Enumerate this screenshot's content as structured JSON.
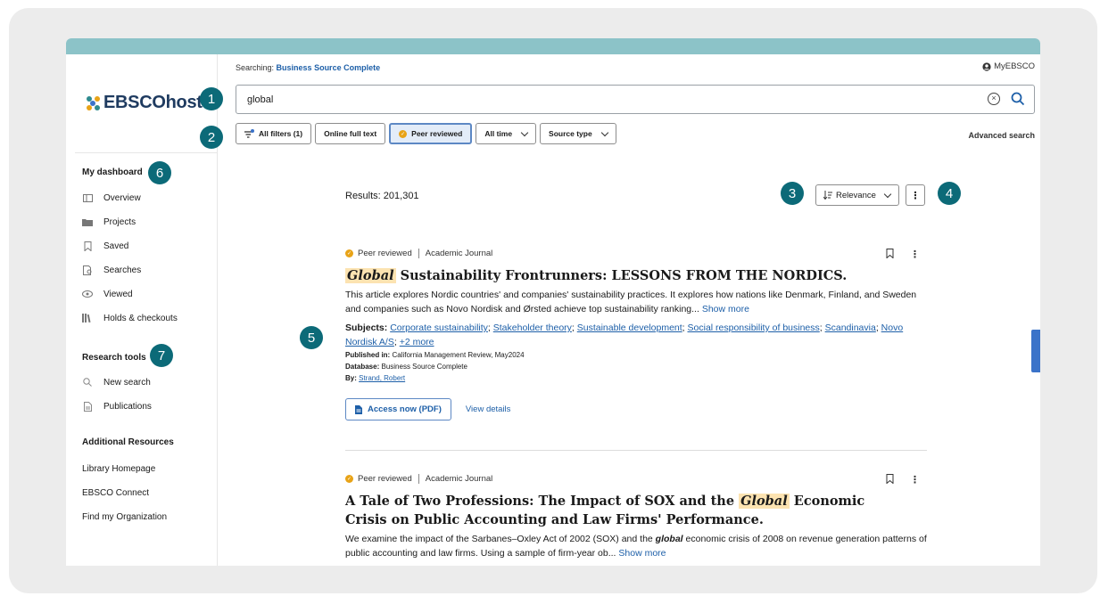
{
  "header": {
    "searching_label": "Searching:",
    "database": "Business Source Complete",
    "account": "MyEBSCO"
  },
  "logo": {
    "text": "EBSCOhost"
  },
  "search": {
    "value": "global"
  },
  "filters": {
    "all_filters": "All filters (1)",
    "online_full_text": "Online full text",
    "peer_reviewed": "Peer reviewed",
    "all_time": "All time",
    "source_type": "Source type",
    "advanced_search": "Advanced search"
  },
  "sidebar": {
    "dashboard_heading": "My dashboard",
    "dashboard_items": [
      {
        "label": "Overview",
        "icon": "overview-icon"
      },
      {
        "label": "Projects",
        "icon": "folder-icon"
      },
      {
        "label": "Saved",
        "icon": "bookmark-icon"
      },
      {
        "label": "Searches",
        "icon": "searches-icon"
      },
      {
        "label": "Viewed",
        "icon": "eye-icon"
      },
      {
        "label": "Holds & checkouts",
        "icon": "books-icon"
      }
    ],
    "tools_heading": "Research tools",
    "tools_items": [
      {
        "label": "New search",
        "icon": "search-icon"
      },
      {
        "label": "Publications",
        "icon": "document-icon"
      }
    ],
    "resources_heading": "Additional Resources",
    "resources_links": [
      "Library Homepage",
      "EBSCO Connect",
      "Find my Organization"
    ]
  },
  "results": {
    "count_label": "Results: 201,301",
    "sort_label": "Relevance",
    "items": [
      {
        "peer_label": "Peer reviewed",
        "type": "Academic Journal",
        "title_highlight": "Global",
        "title_rest": " Sustainability Frontrunners: LESSONS FROM THE NORDICS.",
        "abstract": "This article explores Nordic countries' and companies' sustainability practices. It explores how nations like Denmark, Finland, and Sweden and companies such as Novo Nordisk and Ørsted achieve top sustainability ranking...",
        "show_more": "Show more",
        "subjects_label": "Subjects:",
        "subjects": [
          "Corporate sustainability",
          "Stakeholder theory",
          "Sustainable development",
          "Social responsibility of business",
          "Scandinavia",
          "Novo Nordisk A/S"
        ],
        "subjects_more": "+2 more",
        "published_label": "Published in:",
        "published": "California Management Review, May2024",
        "database_label": "Database:",
        "database": "Business Source Complete",
        "by_label": "By:",
        "author": "Strand, Robert",
        "access_label": "Access now (PDF)",
        "view_details": "View details"
      },
      {
        "peer_label": "Peer reviewed",
        "type": "Academic Journal",
        "title_part1": "A Tale of Two Professions: The Impact of SOX and the ",
        "title_highlight": "Global",
        "title_part2": " Economic Crisis on Public Accounting and Law Firms' Performance.",
        "abstract_part1": "We examine the impact of the Sarbanes–Oxley Act of 2002 (SOX) and the ",
        "abstract_bold": "global",
        "abstract_part2": " economic crisis of 2008 on revenue generation patterns of public accounting and law firms. Using a sample of firm-year ob...",
        "show_more": "Show more"
      }
    ]
  },
  "badges": [
    "1",
    "2",
    "3",
    "4",
    "5",
    "6",
    "7"
  ],
  "colors": {
    "top_bar": "#8cc3c8",
    "badge": "#0c6a78",
    "link": "#1d5fa8",
    "highlight": "#fce3b1",
    "peer_badge": "#e8a317"
  }
}
